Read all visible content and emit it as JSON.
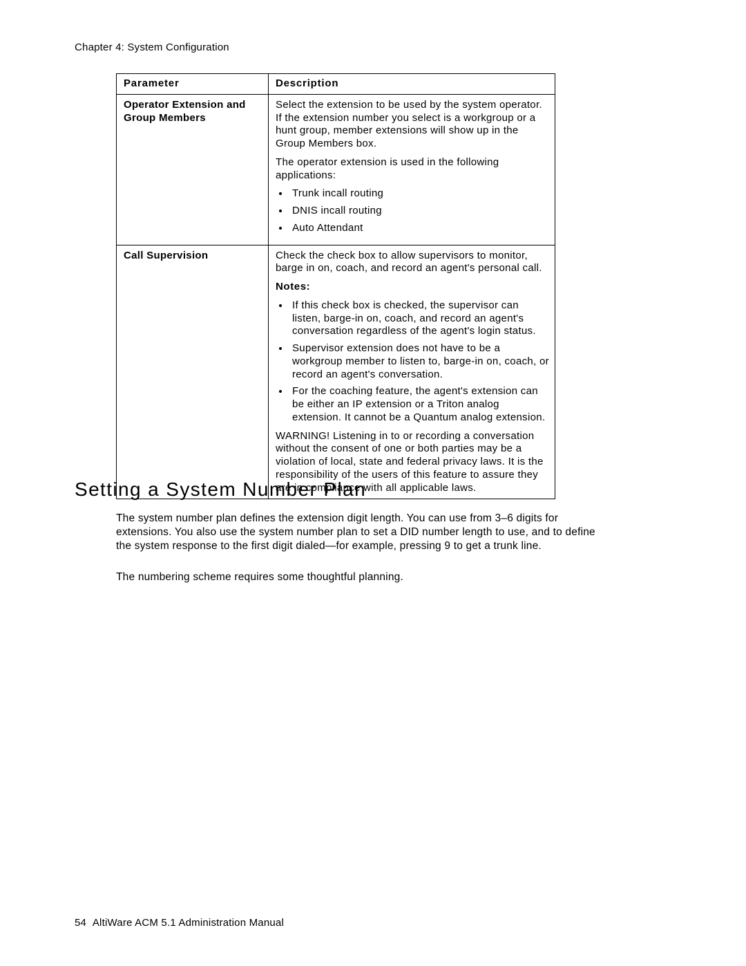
{
  "header": "Chapter 4:  System Configuration",
  "table": {
    "col_parameter": "Parameter",
    "col_description": "Description",
    "rows": {
      "op_ext": {
        "label": "Operator Extension and Group Members",
        "intro": "Select the extension to be used by the system operator. If the extension number you select is a workgroup or a hunt group, member extensions will show up in the Group Members box.",
        "apps_intro": "The operator extension is used in the following applications:",
        "apps": {
          "a1": "Trunk incall routing",
          "a2": "DNIS incall routing",
          "a3": "Auto Attendant"
        }
      },
      "call_sup": {
        "label": "Call Supervision",
        "intro": "Check the check box to allow supervisors to monitor, barge in on, coach, and record an agent's personal call.",
        "notes_label": "Notes:",
        "notes": {
          "n1": "If this check box is checked, the supervisor can listen, barge-in on, coach, and record an agent's conversation regardless of the agent's login status.",
          "n2": "Supervisor extension does not have to be a workgroup member to listen to, barge-in on, coach, or record an agent's conversation.",
          "n3": "For the coaching feature, the agent's extension can be either an IP extension or a Triton analog extension. It cannot be a Quantum analog extension."
        },
        "warning": "WARNING! Listening in to or recording a conversation without the consent of one or both parties may be a violation of local, state and federal privacy laws. It is the responsibility of the users of this feature to assure they are in compliance with all applicable laws."
      }
    }
  },
  "section_heading": "Setting a System Number Plan",
  "body": {
    "p1": "The system number plan defines the extension digit length. You can use from 3–6 digits for extensions. You also use the system number plan to set a DID number length to use, and to define the system response to the first digit dialed—for example, pressing 9 to get a trunk line.",
    "p2": "The numbering scheme requires some thoughtful planning."
  },
  "footer": {
    "page_number": "54",
    "doc_title": "AltiWare ACM 5.1 Administration Manual"
  }
}
